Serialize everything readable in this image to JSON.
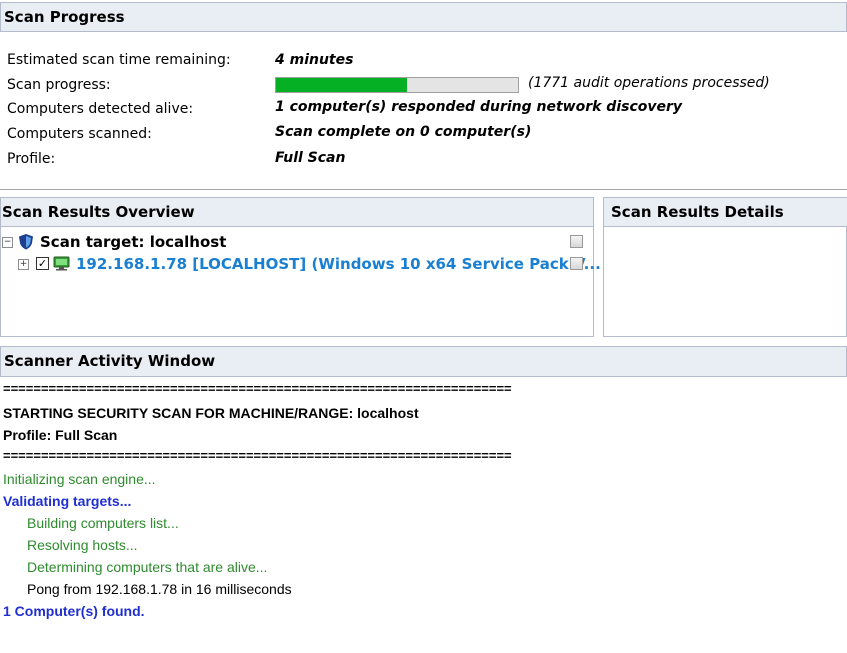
{
  "scan_progress": {
    "header": "Scan Progress",
    "rows": [
      {
        "label": "Estimated scan time remaining:",
        "value": "4 minutes"
      },
      {
        "label": "Scan progress:",
        "value": ""
      },
      {
        "label": "Computers detected alive:",
        "value": "1 computer(s) responded during network discovery"
      },
      {
        "label": "Computers scanned:",
        "value": "Scan complete on 0 computer(s)"
      },
      {
        "label": "Profile:",
        "value": "Full Scan"
      }
    ],
    "progress_fraction": 0.54,
    "progress_note": "(1771 audit operations processed)",
    "progress_color": "#06b025"
  },
  "overview": {
    "header": "Scan Results Overview",
    "target_label": "Scan target: localhost",
    "target_icon": "shield-icon",
    "host_label": "192.168.1.78 [LOCALHOST] (Windows 10 x64 Service Pack V...",
    "host_icon": "computer-icon",
    "host_color": "#1a7fd0"
  },
  "details": {
    "header": "Scan Results Details"
  },
  "activity": {
    "header": "Scanner Activity Window",
    "lines": [
      "===================================================================",
      "STARTING SECURITY SCAN FOR MACHINE/RANGE: localhost",
      "Profile: Full Scan",
      "===================================================================",
      "Initializing scan engine...",
      "Validating targets...",
      "Building computers list...",
      "Resolving hosts...",
      "Determining computers that are alive...",
      "Pong from 192.168.1.78 in 16 milliseconds",
      "1 Computer(s) found."
    ]
  }
}
